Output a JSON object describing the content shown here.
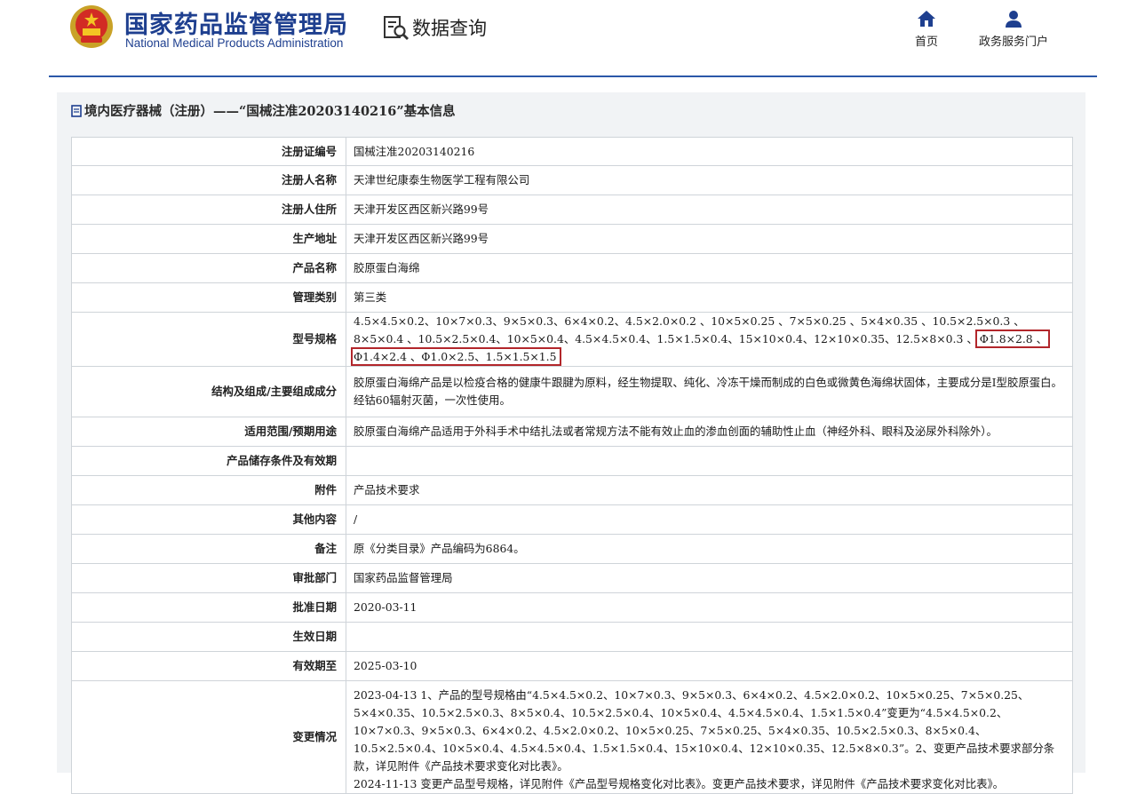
{
  "header": {
    "agency_name_cn": "国家药品监督管理局",
    "agency_name_en": "National Medical Products Administration",
    "data_query": "数据查询",
    "nav": [
      {
        "label": "首页",
        "icon": "home-icon"
      },
      {
        "label": "政务服务门户",
        "icon": "user-icon"
      }
    ],
    "accent_color": "#1e3f8f"
  },
  "panel": {
    "title": "境内医疗器械（注册）——“国械注准20203140216”基本信息"
  },
  "details": {
    "rows": [
      {
        "label": "注册证编号",
        "value": "国械注准20203140216"
      },
      {
        "label": "注册人名称",
        "value": "天津世纪康泰生物医学工程有限公司"
      },
      {
        "label": "注册人住所",
        "value": "天津开发区西区新兴路99号"
      },
      {
        "label": "生产地址",
        "value": "天津开发区西区新兴路99号"
      },
      {
        "label": "产品名称",
        "value": "胶原蛋白海绵"
      },
      {
        "label": "管理类别",
        "value": "第三类"
      },
      {
        "label": "型号规格",
        "value": "4.5×4.5×0.2、10×7×0.3、9×5×0.3、6×4×0.2、4.5×2.0×0.2 、10×5×0.25 、7×5×0.25 、5×4×0.35 、10.5×2.5×0.3 、8×5×0.4 、10.5×2.5×0.4、10×5×0.4、4.5×4.5×0.4、1.5×1.5×0.4、15×10×0.4、12×10×0.35、12.5×8×0.3 、",
        "highlight": "Φ1.8×2.8 、Φ1.4×2.4 、Φ1.0×2.5、1.5×1.5×1.5"
      },
      {
        "label": "结构及组成/主要组成成分",
        "value": "胶原蛋白海绵产品是以检疫合格的健康牛跟腱为原料，经生物提取、纯化、冷冻干燥而制成的白色或微黄色海绵状固体，主要成分是I型胶原蛋白。经钴60辐射灭菌，一次性使用。"
      },
      {
        "label": "适用范围/预期用途",
        "value": "胶原蛋白海绵产品适用于外科手术中结扎法或者常规方法不能有效止血的渗血创面的辅助性止血（神经外科、眼科及泌尿外科除外）。"
      },
      {
        "label": "产品储存条件及有效期",
        "value": ""
      },
      {
        "label": "附件",
        "value": "产品技术要求"
      },
      {
        "label": "其他内容",
        "value": "/"
      },
      {
        "label": "备注",
        "value": "原《分类目录》产品编码为6864。"
      },
      {
        "label": "审批部门",
        "value": "国家药品监督管理局"
      },
      {
        "label": "批准日期",
        "value": "2020-03-11"
      },
      {
        "label": "生效日期",
        "value": ""
      },
      {
        "label": "有效期至",
        "value": "2025-03-10"
      },
      {
        "label": "变更情况",
        "value": "2023-04-13 1、产品的型号规格由“4.5×4.5×0.2、10×7×0.3、9×5×0.3、6×4×0.2、4.5×2.0×0.2、10×5×0.25、7×5×0.25、5×4×0.35、10.5×2.5×0.3、8×5×0.4、10.5×2.5×0.4、10×5×0.4、4.5×4.5×0.4、1.5×1.5×0.4”变更为“4.5×4.5×0.2、10×7×0.3、9×5×0.3、6×4×0.2、4.5×2.0×0.2、10×5×0.25、7×5×0.25、5×4×0.35、10.5×2.5×0.3、8×5×0.4、10.5×2.5×0.4、10×5×0.4、4.5×4.5×0.4、1.5×1.5×0.4、15×10×0.4、12×10×0.35、12.5×8×0.3”。2、变更产品技术要求部分条款，详见附件《产品技术要求变化对比表》。",
        "value2": "2024-11-13 变更产品型号规格，详见附件《产品型号规格变化对比表》。变更产品技术要求，详见附件《产品技术要求变化对比表》。"
      }
    ]
  }
}
